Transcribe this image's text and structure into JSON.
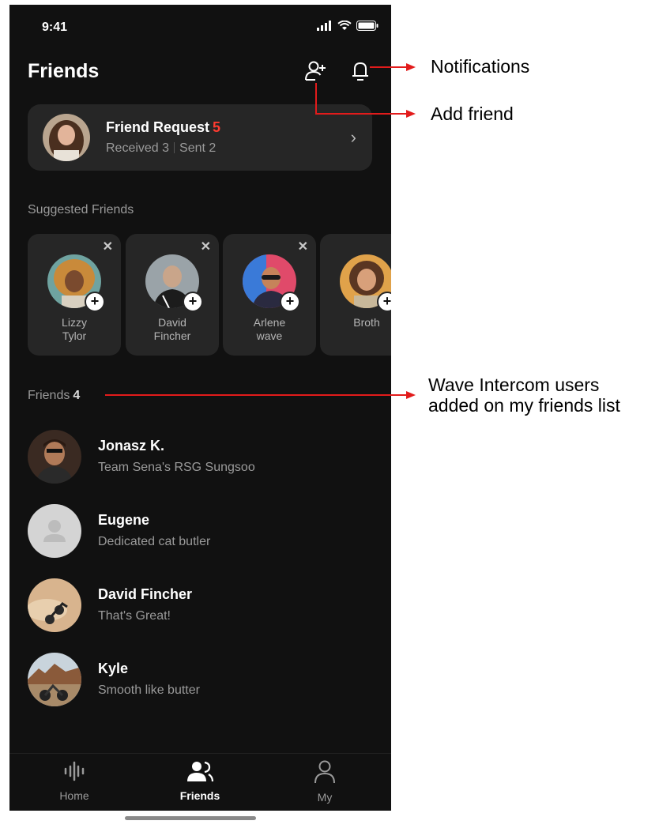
{
  "status_bar": {
    "time": "9:41"
  },
  "header": {
    "title": "Friends",
    "add_friend_icon": "person-plus-icon",
    "notifications_icon": "bell-icon"
  },
  "friend_request": {
    "title": "Friend Request",
    "count": "5",
    "received": "Received 3",
    "sent": "Sent 2"
  },
  "suggested": {
    "heading": "Suggested Friends",
    "items": [
      {
        "line1": "Lizzy",
        "line2": "Tylor"
      },
      {
        "line1": "David",
        "line2": "Fincher"
      },
      {
        "line1": "Arlene",
        "line2": "wave"
      },
      {
        "line1": "Broth",
        "line2": ""
      }
    ]
  },
  "friends": {
    "heading": "Friends",
    "count": "4",
    "items": [
      {
        "name": "Jonasz K.",
        "status": "Team Sena's RSG Sungsoo"
      },
      {
        "name": "Eugene",
        "status": "Dedicated cat butler"
      },
      {
        "name": "David Fincher",
        "status": "That's Great!"
      },
      {
        "name": "Kyle",
        "status": "Smooth like butter"
      }
    ]
  },
  "tabbar": {
    "home": "Home",
    "friends": "Friends",
    "my": "My"
  },
  "annotations": {
    "notifications": "Notifications",
    "add_friend": "Add friend",
    "wave_line1": "Wave Intercom users",
    "wave_line2": "added on my friends list"
  },
  "colors": {
    "accent_red": "#ff3b30",
    "background": "#111111",
    "card": "#262626"
  }
}
